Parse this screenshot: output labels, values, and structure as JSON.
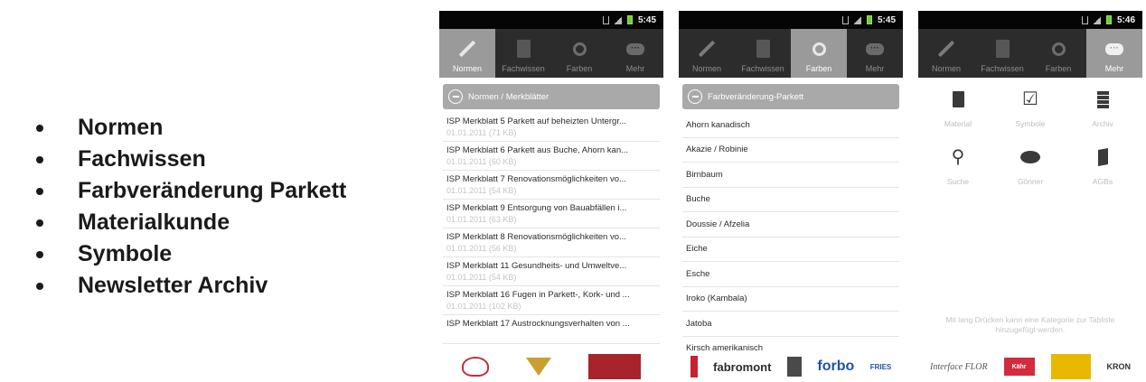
{
  "bullets": [
    "Normen",
    "Fachwissen",
    "Farbveränderung Parkett",
    "Materialkunde",
    "Symbole",
    "Newsletter Archiv"
  ],
  "screens": [
    {
      "time": "5:45",
      "tabs": [
        "Normen",
        "Fachwissen",
        "Farben",
        "Mehr"
      ],
      "active_tab": "Normen",
      "header": "Normen / Merkblätter",
      "items": [
        {
          "title": "ISP Merkblatt 5 Parkett auf beheizten Untergr...",
          "meta": "01.01.2011 (71 KB)"
        },
        {
          "title": "ISP Merkblatt 6 Parkett aus Buche, Ahorn kan...",
          "meta": "01.01.2011 (60 KB)"
        },
        {
          "title": "ISP Merkblatt 7 Renovationsmöglichkeiten vo...",
          "meta": "01.01.2011 (54 KB)"
        },
        {
          "title": "ISP Merkblatt 9 Entsorgung von Bauabfällen i...",
          "meta": "01.01.2011 (63 KB)"
        },
        {
          "title": "ISP Merkblatt 8 Renovationsmöglichkeiten vo...",
          "meta": "01.01.2011 (56 KB)"
        },
        {
          "title": "ISP Merkblatt 11 Gesundheits- und Umweltve...",
          "meta": "01.01.2011 (54 KB)"
        },
        {
          "title": "ISP Merkblatt 16 Fugen in Parkett-, Kork- und ...",
          "meta": "01.01.2011 (102 KB)"
        },
        {
          "title": "ISP Merkblatt 17 Austrocknungsverhalten von ...",
          "meta": ""
        }
      ]
    },
    {
      "time": "5:45",
      "tabs": [
        "Normen",
        "Fachwissen",
        "Farben",
        "Mehr"
      ],
      "active_tab": "Farben",
      "header": "Farbveränderung-Parkett",
      "items": [
        "Ahorn kanadisch",
        "Akazie / Robinie",
        "Birnbaum",
        "Buche",
        "Doussie / Afzelia",
        "Eiche",
        "Esche",
        "Iroko (Kambala)",
        "Jatoba",
        "Kirsch amerikanisch"
      ],
      "sponsors": [
        "fabromont",
        "forbo",
        "FRIES"
      ]
    },
    {
      "time": "5:46",
      "tabs": [
        "Normen",
        "Fachwissen",
        "Farben",
        "Mehr"
      ],
      "active_tab": "Mehr",
      "grid": [
        {
          "label": "Material",
          "icon": "material-icon"
        },
        {
          "label": "Symbole",
          "icon": "checkbox-icon"
        },
        {
          "label": "Archiv",
          "icon": "archive-icon"
        },
        {
          "label": "Suche",
          "icon": "search-icon"
        },
        {
          "label": "Gönner",
          "icon": "piggy-bank-icon"
        },
        {
          "label": "AGBs",
          "icon": "agb-book-icon"
        }
      ],
      "hint": "Mit lang Drücken kann eine Kategorie zur Tabliste hinzugefügt werden.",
      "sponsors": [
        "Interface FLOR",
        "Kähr",
        "KRON"
      ]
    }
  ],
  "colors": {
    "statusbar": "#050505",
    "tabbar": "#2c2c2c",
    "tab_active": "#9a9a9a",
    "section_header": "#a9a9a9",
    "meta_text": "#c4c4c4",
    "forbo_blue": "#1d55a4",
    "sponsor_red": "#a8232a",
    "kahrs_red": "#d42a3c",
    "kron_yellow": "#e8b800"
  }
}
